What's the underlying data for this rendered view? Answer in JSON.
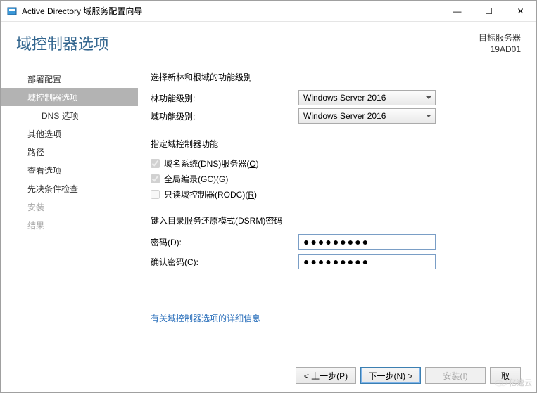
{
  "window": {
    "title": "Active Directory 域服务配置向导",
    "minimize_glyph": "—",
    "maximize_glyph": "☐",
    "close_glyph": "✕"
  },
  "header": {
    "title": "域控制器选项",
    "target_label": "目标服务器",
    "target_value": "19AD01"
  },
  "nav": {
    "items": [
      {
        "label": "部署配置",
        "state": "normal"
      },
      {
        "label": "域控制器选项",
        "state": "selected"
      },
      {
        "label": "DNS 选项",
        "state": "sub"
      },
      {
        "label": "其他选项",
        "state": "normal"
      },
      {
        "label": "路径",
        "state": "normal"
      },
      {
        "label": "查看选项",
        "state": "normal"
      },
      {
        "label": "先决条件检查",
        "state": "normal"
      },
      {
        "label": "安装",
        "state": "disabled"
      },
      {
        "label": "结果",
        "state": "disabled"
      }
    ]
  },
  "content": {
    "func_level_title": "选择新林和根域的功能级别",
    "forest_label": "林功能级别:",
    "domain_label": "域功能级别:",
    "forest_value": "Windows Server 2016",
    "domain_value": "Windows Server 2016",
    "dc_caps_title": "指定域控制器功能",
    "cb_dns": {
      "label_pre": "域名系统(DNS)服务器(",
      "key": "O",
      "label_post": ")",
      "checked": true,
      "enabled": false
    },
    "cb_gc": {
      "label_pre": "全局编录(GC)(",
      "key": "G",
      "label_post": ")",
      "checked": true,
      "enabled": false
    },
    "cb_rodc": {
      "label_pre": "只读域控制器(RODC)(",
      "key": "R",
      "label_post": ")",
      "checked": false,
      "enabled": false
    },
    "dsrm_title": "键入目录服务还原模式(DSRM)密码",
    "password_label": "密码(D):",
    "confirm_label": "确认密码(C):",
    "password_value": "●●●●●●●●●",
    "confirm_value": "●●●●●●●●●",
    "more_link": "有关域控制器选项的详细信息"
  },
  "buttons": {
    "prev": "< 上一步(P)",
    "next": "下一步(N) >",
    "install": "安装(I)",
    "cancel": "取"
  },
  "watermark": "亿速云"
}
